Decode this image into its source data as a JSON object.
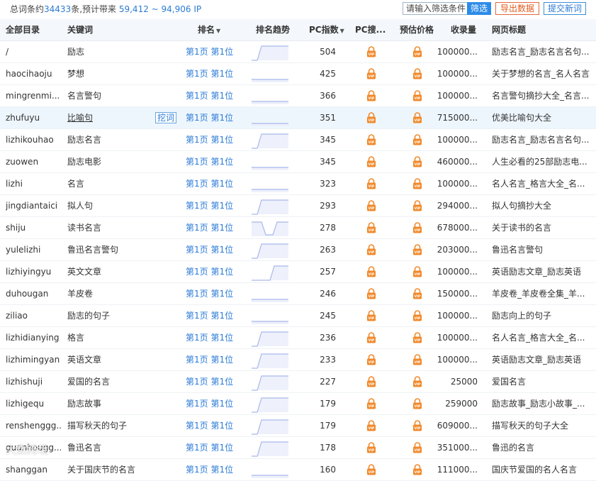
{
  "summary": {
    "prefix": "总词条约",
    "count": "34433",
    "middle": "条,预计带来 ",
    "range": "59,412 ~ 94,906",
    "suffix": " IP"
  },
  "toolbar": {
    "filter_placeholder": "请输入筛选条件",
    "filter_button": "筛选",
    "export_button": "导出数据",
    "submit_button": "提交新词"
  },
  "columns": {
    "directory": "全部目录",
    "keyword": "关键词",
    "rank": "排名",
    "trend": "排名趋势",
    "pc_index": "PC指数",
    "pc_search": "PC搜...",
    "price": "预估价格",
    "volume": "收录量",
    "page_title": "网页标题"
  },
  "dig_label": "挖词",
  "rows": [
    {
      "dir": "/",
      "kw": "励志",
      "rank": "第1页 第1位",
      "trend": "up",
      "pc": "504",
      "vol": "100000...",
      "title": "励志名言_励志名言名句..."
    },
    {
      "dir": "haocihaoju",
      "kw": "梦想",
      "rank": "第1页 第1位",
      "trend": "flat",
      "pc": "425",
      "vol": "100000...",
      "title": "关于梦想的名言_名人名言"
    },
    {
      "dir": "mingrenmi...",
      "kw": "名言警句",
      "rank": "第1页 第1位",
      "trend": "flat",
      "pc": "366",
      "vol": "100000...",
      "title": "名言警句摘抄大全_名言..."
    },
    {
      "dir": "zhufuyu",
      "kw": "比喻句",
      "rank": "第1页 第1位",
      "trend": "flat",
      "pc": "351",
      "vol": "715000...",
      "title": "优美比喻句大全"
    },
    {
      "dir": "lizhikouhao",
      "kw": "励志名言",
      "rank": "第1页 第1位",
      "trend": "up",
      "pc": "345",
      "vol": "100000...",
      "title": "励志名言_励志名言名句..."
    },
    {
      "dir": "zuowen",
      "kw": "励志电影",
      "rank": "第1页 第1位",
      "trend": "flat",
      "pc": "345",
      "vol": "460000...",
      "title": "人生必看的25部励志电..."
    },
    {
      "dir": "lizhi",
      "kw": "名言",
      "rank": "第1页 第1位",
      "trend": "flat",
      "pc": "323",
      "vol": "100000...",
      "title": "名人名言_格言大全_名..."
    },
    {
      "dir": "jingdiantaici",
      "kw": "拟人句",
      "rank": "第1页 第1位",
      "trend": "up",
      "pc": "293",
      "vol": "294000...",
      "title": "拟人句摘抄大全"
    },
    {
      "dir": "shiju",
      "kw": "读书名言",
      "rank": "第1页 第1位",
      "trend": "dip",
      "pc": "278",
      "vol": "678000...",
      "title": "关于读书的名言"
    },
    {
      "dir": "yulelizhi",
      "kw": "鲁迅名言警句",
      "rank": "第1页 第1位",
      "trend": "up",
      "pc": "263",
      "vol": "203000...",
      "title": "鲁迅名言警句"
    },
    {
      "dir": "lizhiyingyu",
      "kw": "英文文章",
      "rank": "第1页 第1位",
      "trend": "late",
      "pc": "257",
      "vol": "100000...",
      "title": "英语励志文章_励志英语"
    },
    {
      "dir": "duhougan",
      "kw": "羊皮卷",
      "rank": "第1页 第1位",
      "trend": "flat",
      "pc": "246",
      "vol": "150000...",
      "title": "羊皮卷_羊皮卷全集_羊..."
    },
    {
      "dir": "ziliao",
      "kw": "励志的句子",
      "rank": "第1页 第1位",
      "trend": "flat",
      "pc": "245",
      "vol": "100000...",
      "title": "励志向上的句子"
    },
    {
      "dir": "lizhidianying",
      "kw": "格言",
      "rank": "第1页 第1位",
      "trend": "up",
      "pc": "236",
      "vol": "100000...",
      "title": "名人名言_格言大全_名..."
    },
    {
      "dir": "lizhimingyan",
      "kw": "英语文章",
      "rank": "第1页 第1位",
      "trend": "up",
      "pc": "233",
      "vol": "100000...",
      "title": "英语励志文章_励志英语"
    },
    {
      "dir": "lizhishuji",
      "kw": "爱国的名言",
      "rank": "第1页 第1位",
      "trend": "up",
      "pc": "227",
      "vol": "25000",
      "title": "爱国名言"
    },
    {
      "dir": "lizhigequ",
      "kw": "励志故事",
      "rank": "第1页 第1位",
      "trend": "up",
      "pc": "179",
      "vol": "259000",
      "title": "励志故事_励志小故事_..."
    },
    {
      "dir": "renshenggg...",
      "kw": "描写秋天的句子",
      "rank": "第1页 第1位",
      "trend": "up",
      "pc": "179",
      "vol": "609000...",
      "title": "描写秋天的句子大全"
    },
    {
      "dir": "guanhougg...",
      "kw": "鲁迅名言",
      "rank": "第1页 第1位",
      "trend": "up",
      "pc": "178",
      "vol": "351000...",
      "title": "鲁迅的名言"
    },
    {
      "dir": "shanggan",
      "kw": "关于国庆节的名言",
      "rank": "第1页 第1位",
      "trend": "flat",
      "pc": "160",
      "vol": "111000...",
      "title": "国庆节爱国的名人名言"
    }
  ],
  "watermark": "大数跨境",
  "colors": {
    "accent": "#2b7bd6",
    "export": "#e25a1a",
    "lock": "#f08a2c",
    "trend_line": "#a9b8ea",
    "trend_fill": "#eef1fb"
  }
}
